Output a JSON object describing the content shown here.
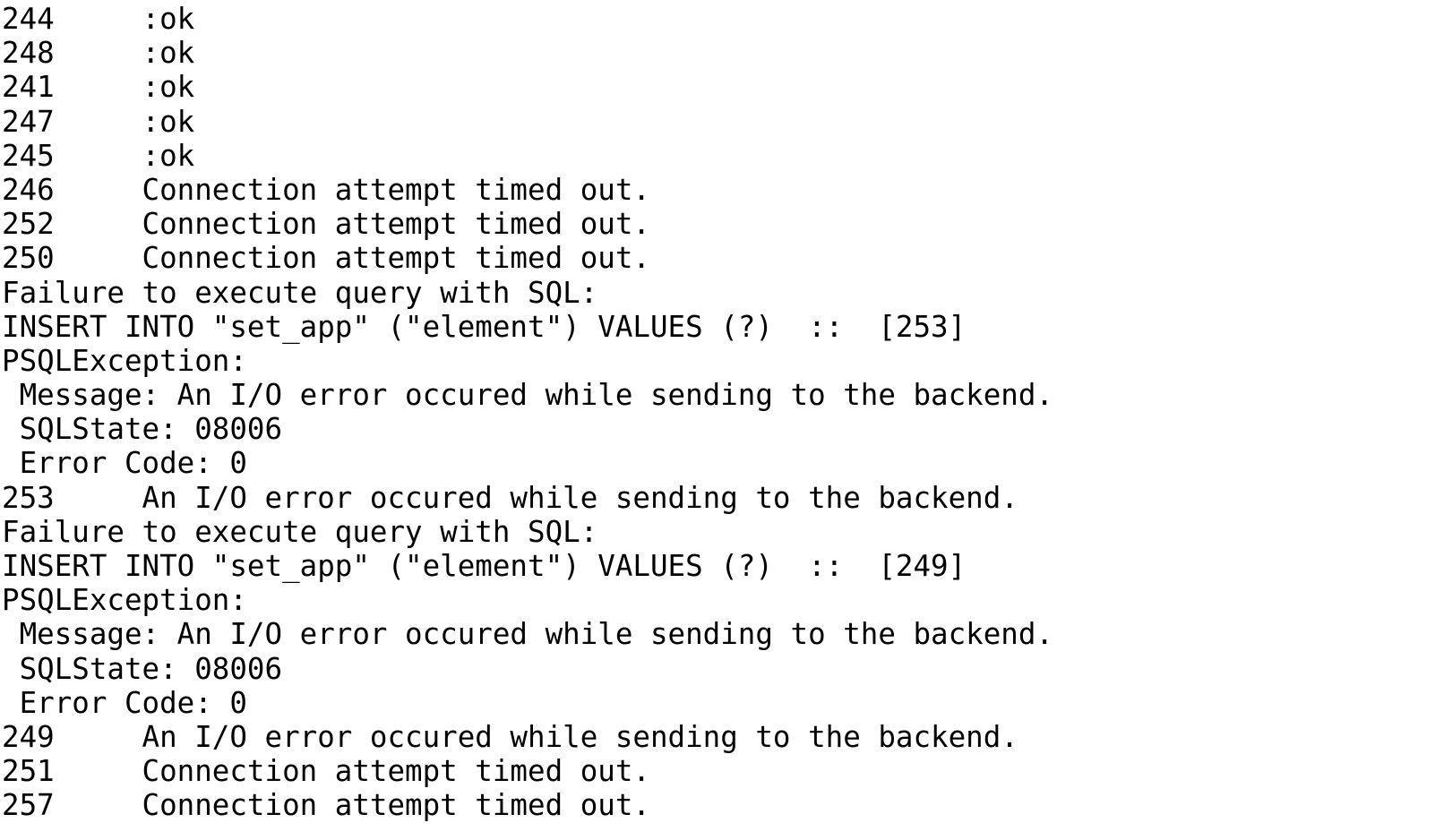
{
  "terminal": {
    "text_color": "#000000",
    "background_color": "#ffffff",
    "lines": [
      "244     :ok",
      "248     :ok",
      "241     :ok",
      "247     :ok",
      "245     :ok",
      "246     Connection attempt timed out.",
      "252     Connection attempt timed out.",
      "250     Connection attempt timed out.",
      "Failure to execute query with SQL:",
      "INSERT INTO \"set_app\" (\"element\") VALUES (?)  ::  [253]",
      "PSQLException:",
      " Message: An I/O error occured while sending to the backend.",
      " SQLState: 08006",
      " Error Code: 0",
      "253     An I/O error occured while sending to the backend.",
      "Failure to execute query with SQL:",
      "INSERT INTO \"set_app\" (\"element\") VALUES (?)  ::  [249]",
      "PSQLException:",
      " Message: An I/O error occured while sending to the backend.",
      " SQLState: 08006",
      " Error Code: 0",
      "249     An I/O error occured while sending to the backend.",
      "251     Connection attempt timed out.",
      "257     Connection attempt timed out."
    ]
  }
}
